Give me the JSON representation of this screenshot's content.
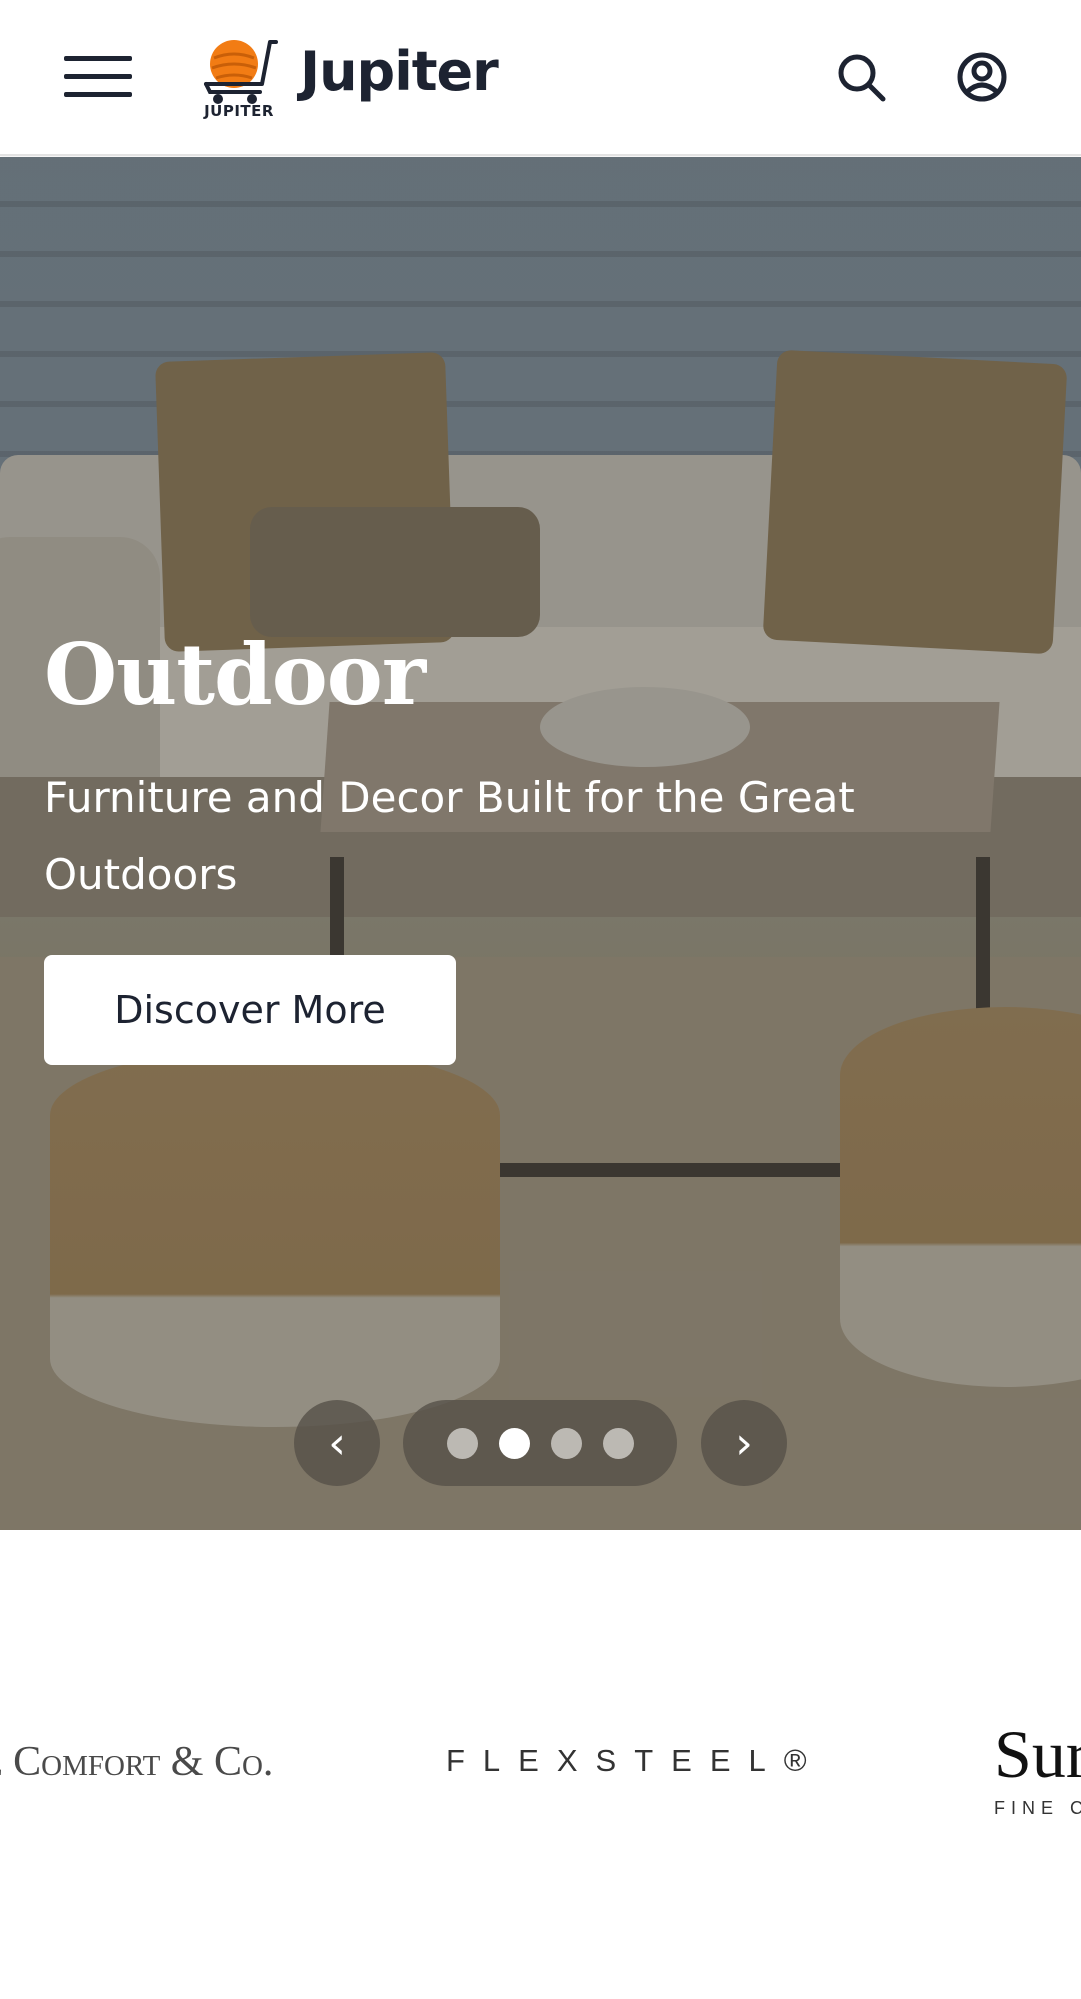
{
  "header": {
    "menu_icon": "hamburger-menu-icon",
    "logo_text": "JUPITER",
    "brand_name": "Jupiter",
    "search_icon": "search-icon",
    "account_icon": "user-account-icon",
    "logo_orange": "#f27c14",
    "text_color": "#1d2331"
  },
  "hero": {
    "title": "Outdoor",
    "subtitle": "Furniture and Decor Built for the Great Outdoors",
    "cta_label": "Discover More",
    "prev_symbol": "‹",
    "next_symbol": "›",
    "slides_total": 4,
    "active_slide": 2
  },
  "brands": {
    "items": [
      {
        "label": "al Comfort & Co."
      },
      {
        "label": "FLEXSTEEL®"
      },
      {
        "label": "Sur"
      }
    ],
    "third_sub": "FINE C"
  }
}
